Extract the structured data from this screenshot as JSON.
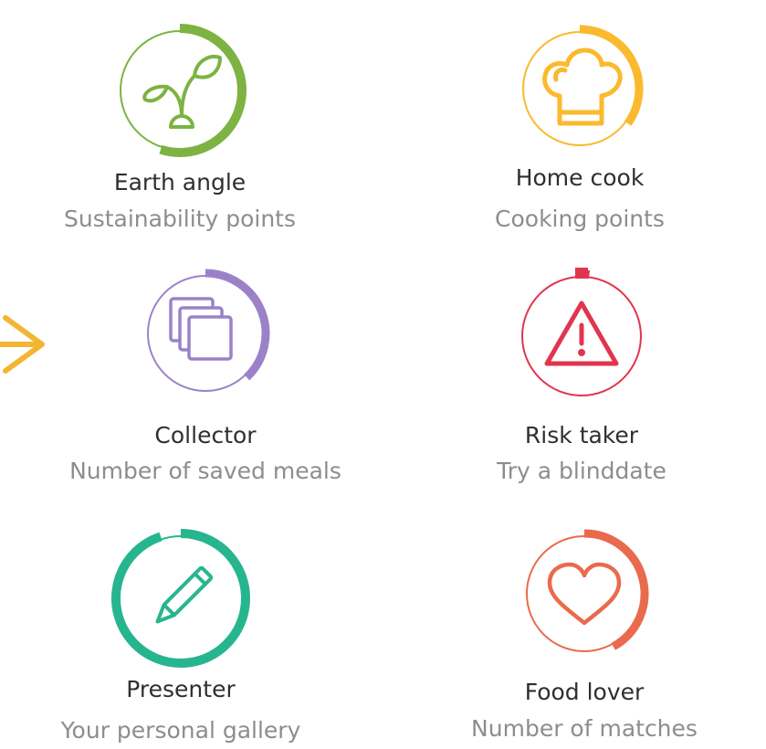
{
  "badges": [
    {
      "title": "Earth angle",
      "subtitle": "Sustainability points",
      "icon": "sprout-icon",
      "color": "#7cb342",
      "progress": 0.55
    },
    {
      "title": "Home cook",
      "subtitle": "Cooking points",
      "icon": "chef-hat-icon",
      "color": "#fbb92d",
      "progress": 0.35
    },
    {
      "title": "Collector",
      "subtitle": "Number of saved meals",
      "icon": "stacked-cards-icon",
      "color": "#9b82c8",
      "progress": 0.38
    },
    {
      "title": "Risk taker",
      "subtitle": "Try a blinddate",
      "icon": "warning-icon",
      "color": "#e1354f",
      "progress": 0.02
    },
    {
      "title": "Presenter",
      "subtitle": "Your personal gallery",
      "icon": "pencil-icon",
      "color": "#27b58f",
      "progress": 0.95
    },
    {
      "title": "Food lover",
      "subtitle": "Number of matches",
      "icon": "heart-icon",
      "color": "#ea6a4d",
      "progress": 0.42
    }
  ],
  "colors": {
    "arrow": "#f2b632"
  }
}
